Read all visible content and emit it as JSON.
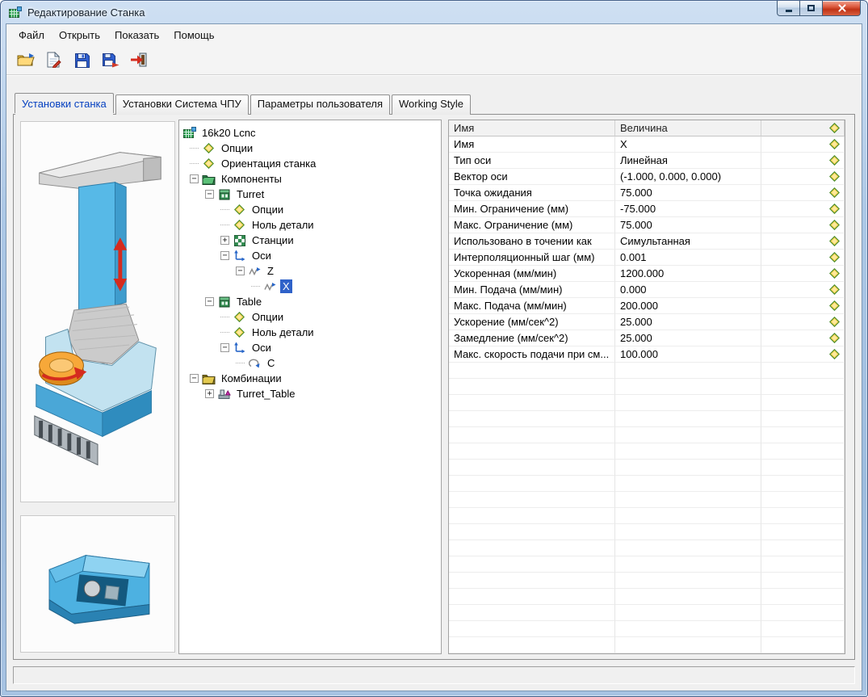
{
  "window": {
    "title": "Редактирование Станка"
  },
  "menu": {
    "items": [
      "Файл",
      "Открыть",
      "Показать",
      "Помощь"
    ]
  },
  "toolbar": {
    "buttons": [
      {
        "name": "open-folder-button",
        "icon": "open-folder-icon"
      },
      {
        "name": "open-document-button",
        "icon": "open-document-icon"
      },
      {
        "name": "save-button",
        "icon": "save-icon"
      },
      {
        "name": "save-as-button",
        "icon": "save-as-icon"
      },
      {
        "name": "exit-button",
        "icon": "exit-icon"
      }
    ]
  },
  "tabs": [
    {
      "name": "tab-machine-settings",
      "label": "Установки станка",
      "active": true
    },
    {
      "name": "tab-cnc-settings",
      "label": "Установки Система ЧПУ",
      "active": false
    },
    {
      "name": "tab-user-parameters",
      "label": "Параметры пользователя",
      "active": false
    },
    {
      "name": "tab-working-style",
      "label": "Working Style",
      "active": false
    }
  ],
  "tree": {
    "nodes": [
      {
        "label": "16k20 Lcnc",
        "depth": 0,
        "expand": null,
        "icon": "machine-icon",
        "selected": false
      },
      {
        "label": "Опции",
        "depth": 1,
        "expand": null,
        "icon": "option-diamond-icon",
        "selected": false
      },
      {
        "label": "Ориентация станка",
        "depth": 1,
        "expand": null,
        "icon": "option-diamond-icon",
        "selected": false
      },
      {
        "label": "Компоненты",
        "depth": 1,
        "expand": "minus",
        "icon": "components-folder-icon",
        "selected": false
      },
      {
        "label": "Turret",
        "depth": 2,
        "expand": "minus",
        "icon": "component-icon",
        "selected": false
      },
      {
        "label": "Опции",
        "depth": 3,
        "expand": null,
        "icon": "option-diamond-icon",
        "selected": false
      },
      {
        "label": "Ноль детали",
        "depth": 3,
        "expand": null,
        "icon": "option-diamond-icon",
        "selected": false
      },
      {
        "label": "Станции",
        "depth": 3,
        "expand": "plus",
        "icon": "stations-icon",
        "selected": false
      },
      {
        "label": "Оси",
        "depth": 3,
        "expand": "minus",
        "icon": "axes-icon",
        "selected": false
      },
      {
        "label": "Z",
        "depth": 4,
        "expand": "minus",
        "icon": "linear-axis-icon",
        "selected": false
      },
      {
        "label": "X",
        "depth": 5,
        "expand": null,
        "icon": "linear-axis-icon",
        "selected": true
      },
      {
        "label": "Table",
        "depth": 2,
        "expand": "minus",
        "icon": "component-icon",
        "selected": false
      },
      {
        "label": "Опции",
        "depth": 3,
        "expand": null,
        "icon": "option-diamond-icon",
        "selected": false
      },
      {
        "label": "Ноль детали",
        "depth": 3,
        "expand": null,
        "icon": "option-diamond-icon",
        "selected": false
      },
      {
        "label": "Оси",
        "depth": 3,
        "expand": "minus",
        "icon": "axes-icon",
        "selected": false
      },
      {
        "label": "C",
        "depth": 4,
        "expand": null,
        "icon": "rotary-axis-icon",
        "selected": false
      },
      {
        "label": "Комбинации",
        "depth": 1,
        "expand": "minus",
        "icon": "combinations-folder-icon",
        "selected": false
      },
      {
        "label": "Turret_Table",
        "depth": 2,
        "expand": "plus",
        "icon": "combination-icon",
        "selected": false
      }
    ]
  },
  "properties": {
    "headers": [
      "Имя",
      "Величина"
    ],
    "rows": [
      [
        "Имя",
        "X"
      ],
      [
        "Тип оси",
        "Линейная"
      ],
      [
        "Вектор оси",
        "(-1.000, 0.000, 0.000)"
      ],
      [
        "Точка ожидания",
        "75.000"
      ],
      [
        "Мин. Ограничение (мм)",
        "-75.000"
      ],
      [
        "Макс. Ограничение (мм)",
        "75.000"
      ],
      [
        "Использовано в точении как",
        "Симультанная"
      ],
      [
        "Интерполяционный шаг (мм)",
        "0.001"
      ],
      [
        "Ускоренная (мм/мин)",
        "1200.000"
      ],
      [
        "Мин. Подача (мм/мин)",
        "0.000"
      ],
      [
        "Макс. Подача (мм/мин)",
        "200.000"
      ],
      [
        "Ускорение (мм/сек^2)",
        "25.000"
      ],
      [
        "Замедление (мм/сек^2)",
        "25.000"
      ],
      [
        "Макс. скорость подачи при см...",
        "100.000"
      ]
    ],
    "empty_row_count": 18
  },
  "colors": {
    "active_tab_text": "#0540c0",
    "tree_selection": "#2f62c9",
    "close_button": "#c03317",
    "option_diamond": "#ffd24a",
    "component_green": "#2f8a4e",
    "machine_blue": "#54b7e4",
    "rotary_orange": "#f7a839",
    "arrow_red": "#d52b1e"
  }
}
